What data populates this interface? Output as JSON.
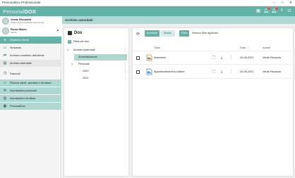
{
  "window": {
    "title": "PersonalDox Professionale",
    "controls": [
      "–",
      "□",
      "✕"
    ]
  },
  "app": {
    "brand_light": "Personal",
    "brand_bold": "DOX",
    "header_badges": [
      "2",
      "3"
    ]
  },
  "sidebar": {
    "users": [
      {
        "name": "Verde Riccardo",
        "role": "Studio verde  [Operatore autonomo]"
      },
      {
        "name": "Rossi Mario",
        "role": "Utente"
      }
    ],
    "items": [
      {
        "label": "Gestione utente",
        "icon": "person-icon",
        "state": "sel"
      },
      {
        "label": "Scrivania",
        "icon": "desk-icon",
        "state": "plain"
      },
      {
        "label": "Archivio condiviso dall'utente",
        "icon": "share-icon",
        "state": "plain"
      },
      {
        "label": "Archivio aziendale",
        "icon": "folder-icon",
        "state": "grey"
      },
      {
        "label": "Fascicoli",
        "icon": "files-icon",
        "state": "plain"
      },
      {
        "label": "Ricerca utenti, operatori e strutture",
        "icon": "search-icon",
        "state": "teal"
      },
      {
        "label": "Impostazioni personali",
        "icon": "gear-icon",
        "state": "teal"
      },
      {
        "label": "Impostazioni struttura",
        "icon": "building-icon",
        "state": "teal"
      },
      {
        "label": "PersonalDox",
        "icon": "window-icon",
        "state": "teal"
      }
    ]
  },
  "main": {
    "section_title": "Archivio aziendale",
    "tree": {
      "title": "Dox",
      "filter_label": "Filtra per dox",
      "nodes": [
        {
          "label": "Archivio aziendale",
          "level": 0,
          "expanded": true,
          "selected": false
        },
        {
          "label": "Amministrazioni",
          "level": 1,
          "expanded": false,
          "selected": true
        },
        {
          "label": "Personali",
          "level": 1,
          "expanded": true,
          "selected": false
        },
        {
          "label": "2020",
          "level": 2,
          "expanded": false,
          "selected": false
        },
        {
          "label": "2021",
          "level": 2,
          "expanded": false,
          "selected": false
        }
      ]
    },
    "docs": {
      "tab_archived": "Archiviati",
      "tab_drafts": "Bozze",
      "filter_button": "Filtra",
      "no_filter": "Nessun filtro applicato",
      "columns": {
        "title": "Titolo",
        "date": "Data",
        "author": "Autore"
      },
      "sort_indicator": "↓",
      "rows": [
        {
          "title": "Anamnesi",
          "date": "24-06-2021",
          "author": "Verde Riccardo"
        },
        {
          "title": "Approfondimenti su Albert",
          "date": "24-06-2021",
          "author": "Verde Riccardo"
        }
      ]
    }
  },
  "colors": {
    "accent": "#63b2a7",
    "accent_light": "#aed8d1"
  }
}
